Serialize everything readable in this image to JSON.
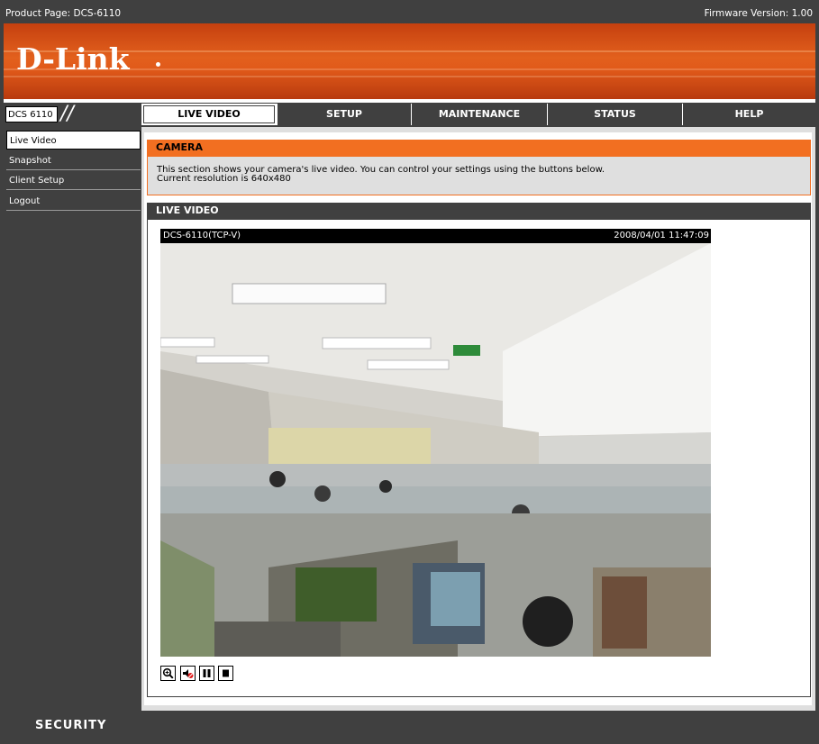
{
  "top_bar": {
    "product": "Product Page: DCS-6110",
    "firmware": "Firmware Version: 1.00"
  },
  "brand": {
    "logo": "D-Link",
    "accent": "#f26f21",
    "dark": "#404040"
  },
  "nav": {
    "model": "DCS 6110",
    "tabs": [
      {
        "label": "LIVE VIDEO",
        "active": true
      },
      {
        "label": "SETUP"
      },
      {
        "label": "MAINTENANCE"
      },
      {
        "label": "STATUS"
      },
      {
        "label": "HELP"
      }
    ]
  },
  "sidebar": {
    "items": [
      {
        "label": "Live Video",
        "active": true
      },
      {
        "label": "Snapshot"
      },
      {
        "label": "Client Setup"
      },
      {
        "label": "Logout"
      }
    ]
  },
  "camera": {
    "title": "CAMERA",
    "line1": "This section shows your camera's live video. You can control your settings using the buttons below.",
    "line2": "Current resolution is 640x480"
  },
  "live_video": {
    "title": "LIVE VIDEO",
    "overlay_left": "DCS-6110(TCP-V)",
    "overlay_right": "2008/04/01 11:47:09",
    "controls": [
      "zoom-icon",
      "mute-icon",
      "pause-icon",
      "stop-icon"
    ]
  },
  "footer": {
    "label": "SECURITY"
  }
}
